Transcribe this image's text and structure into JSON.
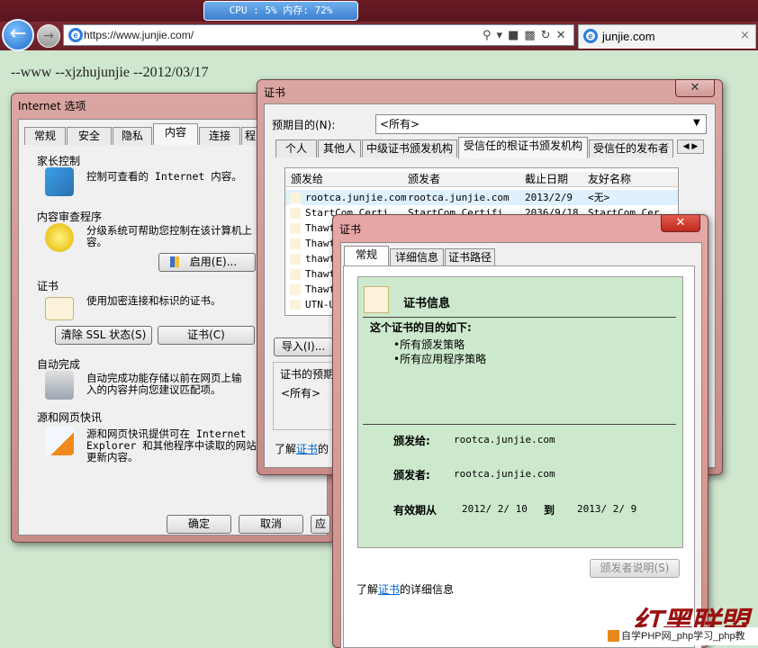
{
  "system": {
    "cpu_label": "CPU : 5%   内存: 72%"
  },
  "browser": {
    "url": "https://www.junjie.com/",
    "tab_title": "junjie.com",
    "tab_close": "×",
    "page_text": "--www --xjzhujunjie --2012/03/17"
  },
  "internet_options": {
    "title": "Internet 选项",
    "tabs": [
      "常规",
      "安全",
      "隐私",
      "内容",
      "连接",
      "程"
    ],
    "parental": {
      "heading": "家长控制",
      "desc": "控制可查看的 Internet 内容。"
    },
    "advisor": {
      "heading": "内容审查程序",
      "desc": "分级系统可帮助您控制在该计算机上\n容。",
      "enable_button": "启用(E)..."
    },
    "certs": {
      "heading": "证书",
      "desc": "使用加密连接和标识的证书。",
      "clear_ssl": "清除 SSL 状态(S)",
      "certs_button": "证书(C)"
    },
    "autocomplete": {
      "heading": "自动完成",
      "desc": "自动完成功能存储以前在网页上输\n入的内容并向您建议匹配项。"
    },
    "feeds": {
      "heading": "源和网页快讯",
      "desc": "源和网页快讯提供可在 Internet\nExplorer 和其他程序中读取的网站\n更新内容。"
    },
    "ok": "确定",
    "cancel": "取消",
    "apply": "应"
  },
  "cert_manager": {
    "title": "证书",
    "purpose_label": "预期目的(N):",
    "purpose_value": "<所有>",
    "tabs": [
      "个人",
      "其他人",
      "中级证书颁发机构",
      "受信任的根证书颁发机构",
      "受信任的发布者"
    ],
    "columns": [
      "颁发给",
      "颁发者",
      "截止日期",
      "友好名称"
    ],
    "rows": [
      [
        "rootca.junjie.com",
        "rootca.junjie.com",
        "2013/2/9",
        "<无>"
      ],
      [
        "StartCom Certi...",
        "StartCom Certifi...",
        "2036/9/18",
        "StartCom Cer..."
      ],
      [
        "Thawte",
        "",
        "",
        ""
      ],
      [
        "Thawt",
        "",
        "",
        ""
      ],
      [
        "thawt",
        "",
        "",
        ""
      ],
      [
        "Thawt",
        "",
        "",
        ""
      ],
      [
        "Thawt",
        "",
        "",
        ""
      ],
      [
        "UTN-U",
        "",
        "",
        ""
      ]
    ],
    "import_button": "导入(I)...",
    "purpose_section": "证书的预期",
    "purpose_all": "<所有>",
    "learn_more_prefix": "了解",
    "learn_more_link": "证书",
    "learn_more_suffix": "的"
  },
  "cert_detail": {
    "title": "证书",
    "tabs": [
      "常规",
      "详细信息",
      "证书路径"
    ],
    "info_heading": "证书信息",
    "purpose_heading": "这个证书的目的如下:",
    "purposes": [
      "•所有颁发策略",
      "•所有应用程序策略"
    ],
    "issued_to_label": "颁发给:",
    "issued_to_value": "rootca.junjie.com",
    "issued_by_label": "颁发者:",
    "issued_by_value": "rootca.junjie.com",
    "validity_label": "有效期从",
    "valid_from": "2012/ 2/ 10",
    "to_label": "到",
    "valid_to": "2013/ 2/ 9",
    "issuer_statement": "颁发者说明(S)",
    "learn_more_prefix": "了解",
    "learn_more_link": "证书",
    "learn_more_suffix": "的详细信息"
  },
  "overlay": {
    "logo": "红黑联盟",
    "watermark": "自学PHP网_php学习_php教"
  },
  "colors": {
    "window_frame": "#d9a09e",
    "cert_green": "#cde9cd",
    "link": "#0066cc"
  }
}
